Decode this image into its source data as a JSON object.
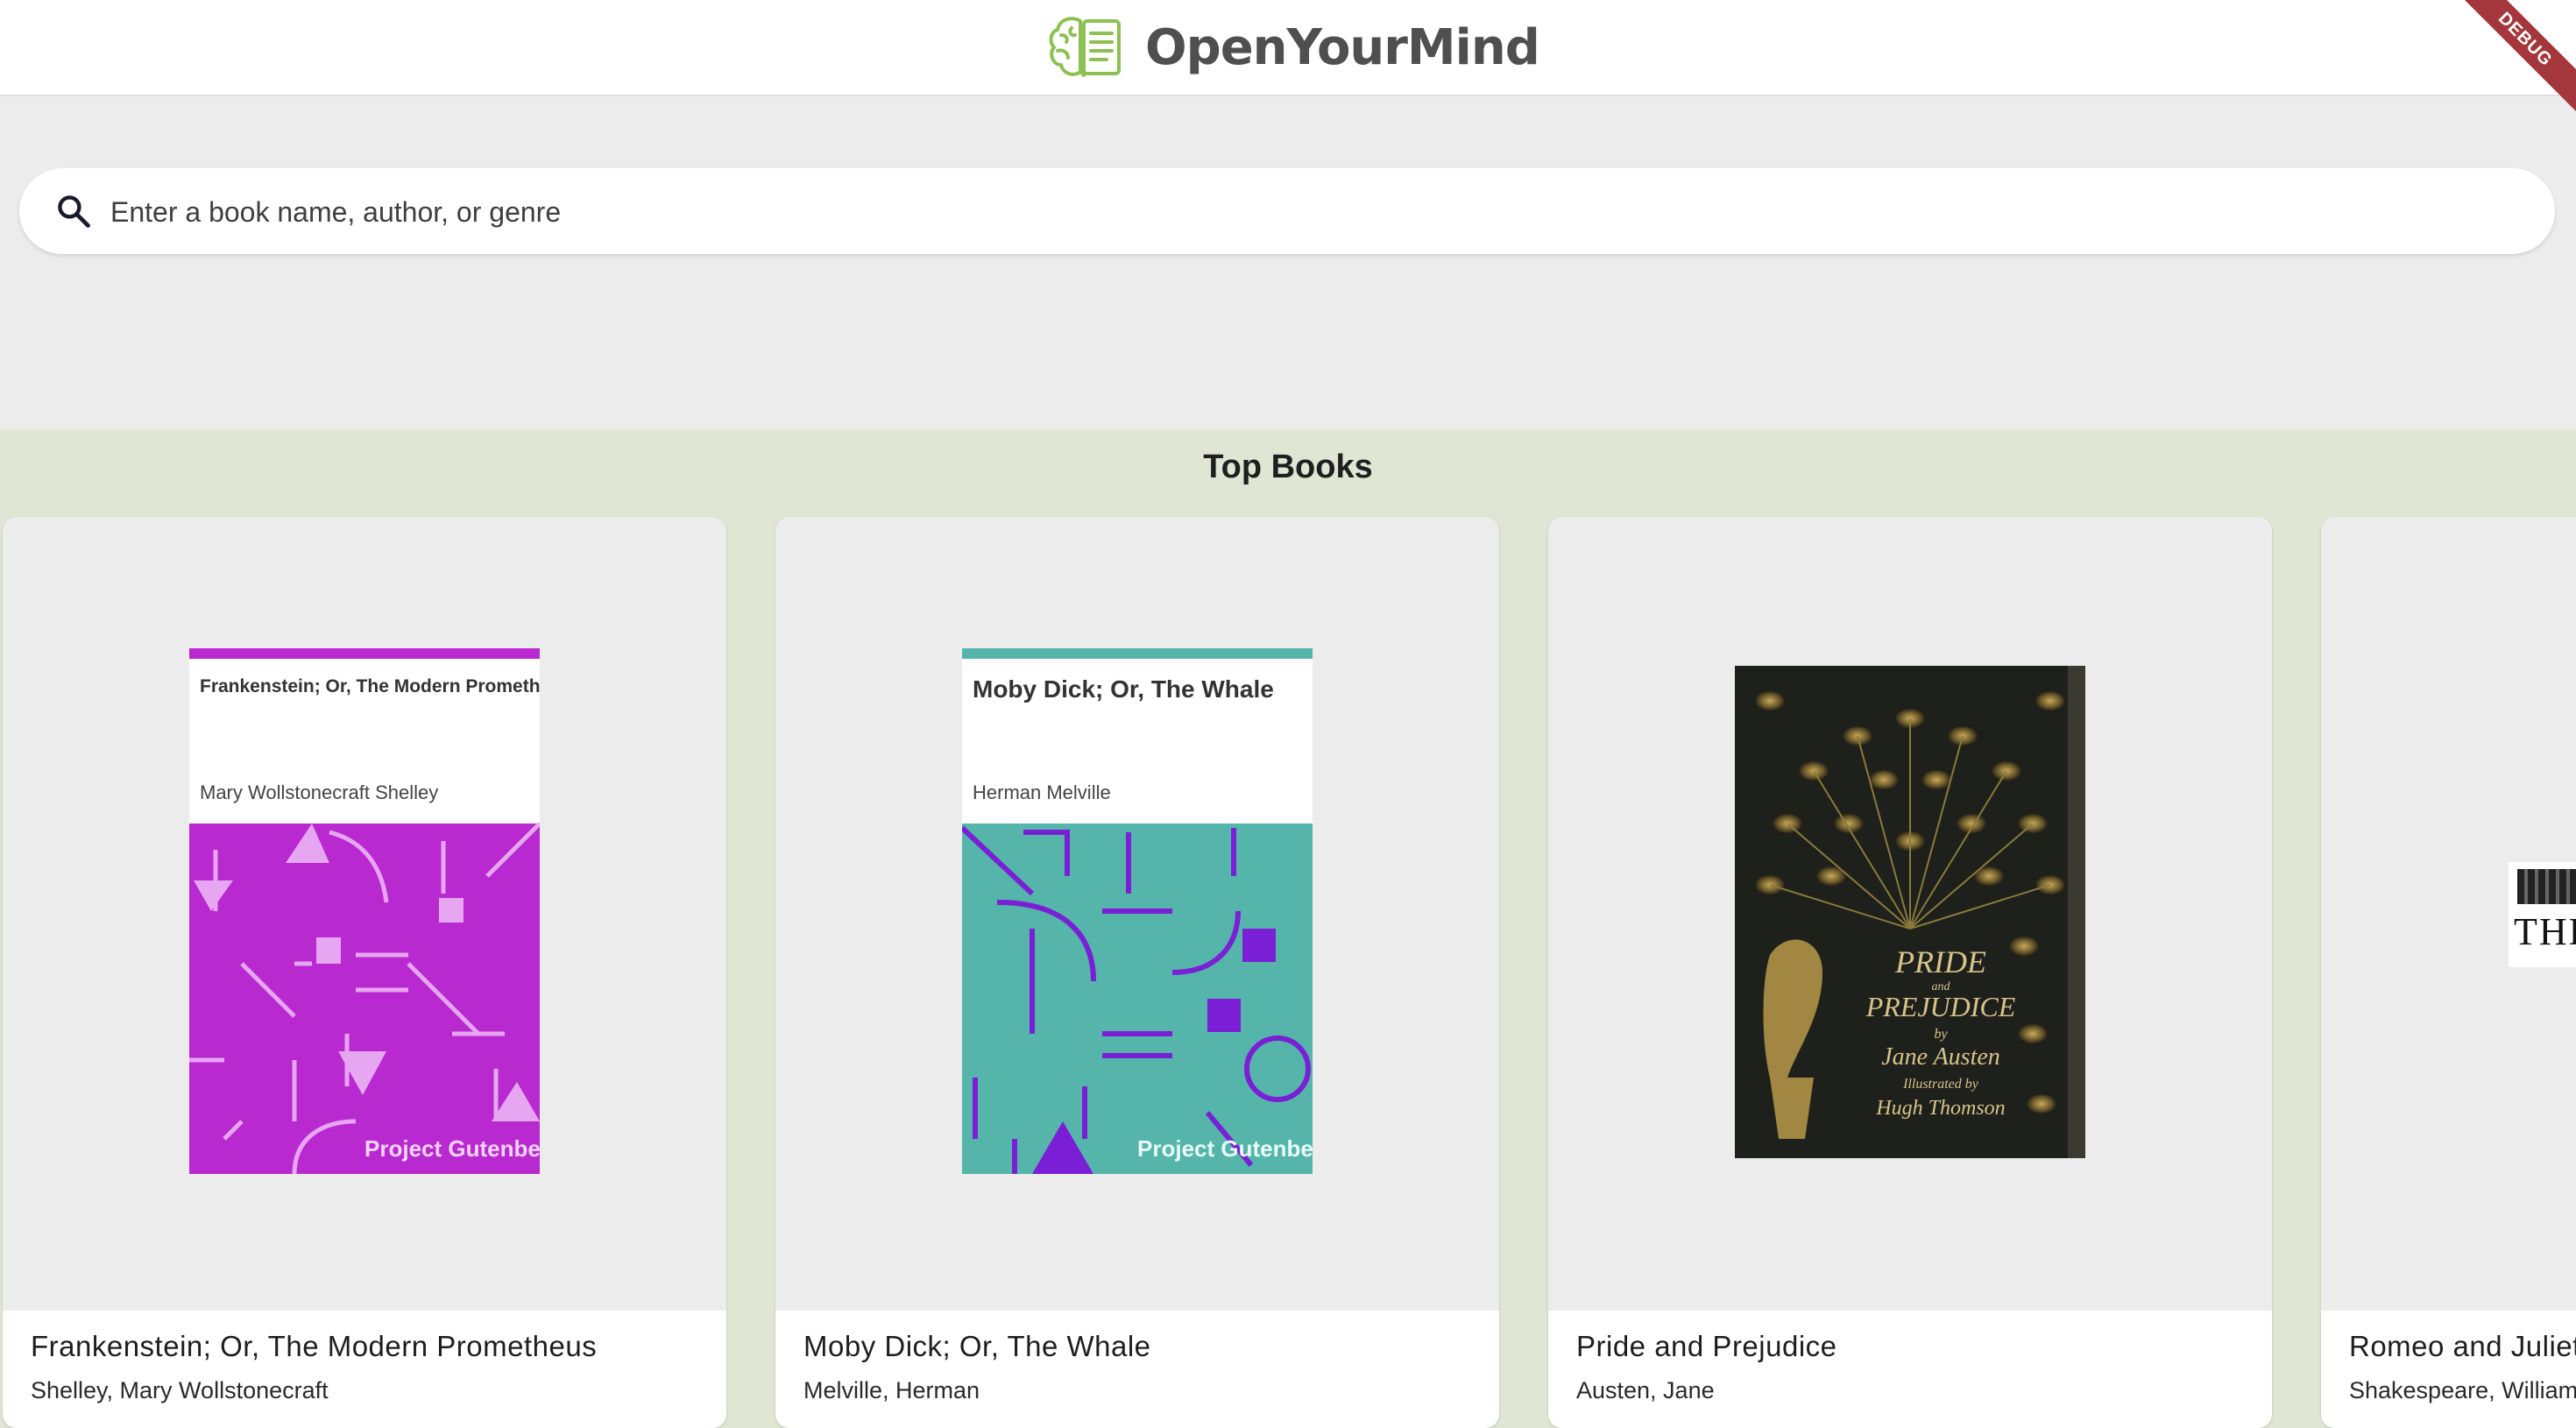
{
  "app": {
    "name": "OpenYourMind",
    "debug_label": "DEBUG"
  },
  "search": {
    "placeholder": "Enter a book name, author, or genre"
  },
  "top_books": {
    "heading": "Top Books",
    "books": [
      {
        "title": "Frankenstein; Or, The Modern Prometheus",
        "author": "Shelley, Mary Wollstonecraft",
        "cover_title": "Frankenstein; Or, The Modern Prometheus",
        "cover_author": "Mary Wollstonecraft Shelley",
        "cover_publisher": "Project Gutenberg",
        "cover_color": "#b829d0"
      },
      {
        "title": "Moby Dick; Or, The Whale",
        "author": "Melville, Herman",
        "cover_title": "Moby Dick; Or, The Whale",
        "cover_author": "Herman Melville",
        "cover_publisher": "Project Gutenberg",
        "cover_color": "#55b5ab"
      },
      {
        "title": "Pride and Prejudice",
        "author": "Austen, Jane",
        "cover_text": [
          "PRIDE",
          "and",
          "PREJUDICE",
          "by",
          "Jane Austen",
          "Illustrated by",
          "Hugh Thomson"
        ]
      },
      {
        "title": "Romeo and Juliet",
        "author": "Shakespeare, William",
        "cover_text": "THE"
      }
    ]
  },
  "colors": {
    "section_bg": "#dfe6d3",
    "logo_green": "#8cc152"
  }
}
